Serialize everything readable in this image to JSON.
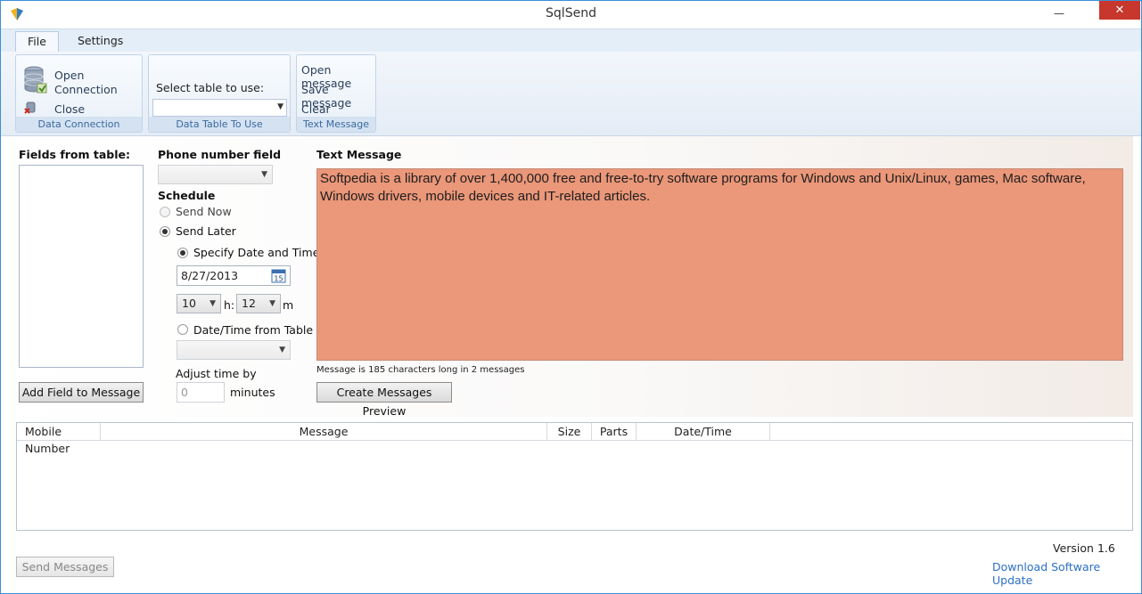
{
  "window": {
    "title": "SqlSend",
    "minimize_glyph": "—",
    "close_glyph": "✕"
  },
  "tabs": [
    {
      "label": "File"
    },
    {
      "label": "Settings"
    }
  ],
  "ribbon": {
    "data_connection": {
      "open_line1": "Open",
      "open_line2": "Connection",
      "close": "Close Connection",
      "group_label": "Data Connection",
      "icons": [
        "database-icon",
        "database-disconnect-icon"
      ]
    },
    "data_table": {
      "select_label": "Select table to use:",
      "selected_value": "",
      "group_label": "Data Table To Use"
    },
    "text_message": {
      "open": "Open message",
      "save": "Save message",
      "clear": "Clear Message",
      "group_label": "Text Message"
    }
  },
  "fields": {
    "label": "Fields from table:",
    "items": [],
    "add_button": "Add Field to Message"
  },
  "phone": {
    "label": "Phone number field",
    "selected": ""
  },
  "schedule": {
    "label": "Schedule",
    "send_now": "Send Now",
    "send_later": "Send Later",
    "specify": "Specify Date and Time",
    "date": "8/27/2013",
    "hour": "10",
    "hour_suffix": "h:",
    "minute": "12",
    "minute_suffix": "m",
    "from_table": "Date/Time from Table",
    "from_table_selected": "",
    "adjust_label": "Adjust time by",
    "adjust_value": "0",
    "adjust_suffix": "minutes",
    "calendar_icon_day": "15"
  },
  "message": {
    "label": "Text Message",
    "text": "Softpedia is a library of over 1,400,000 free and free-to-try software programs for Windows and Unix/Linux, games, Mac software, Windows drivers, mobile devices and IT-related articles.",
    "length_info": "Message is 185 characters long in 2 messages",
    "preview_button": "Create Messages Preview",
    "background_color": "#eb9779"
  },
  "grid": {
    "columns": [
      "Mobile Number",
      "Message",
      "Size",
      "Parts",
      "Date/Time"
    ],
    "rows": []
  },
  "footer": {
    "send_button": "Send Messages",
    "version": "Version 1.6",
    "update_link": "Download Software Update"
  },
  "colors": {
    "accent": "#3b8fd8",
    "close_button": "#c7372b",
    "link": "#2c70c3"
  }
}
